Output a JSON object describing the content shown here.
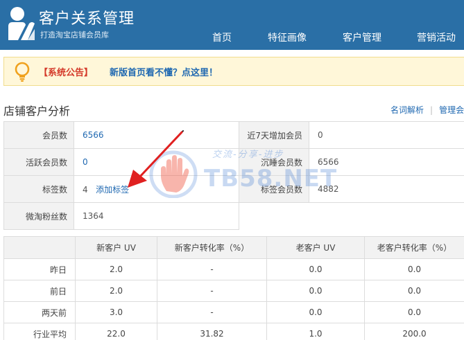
{
  "header": {
    "title": "客户关系管理",
    "subtitle": "打造淘宝店铺会员库",
    "logo_icon": "user-badge-icon",
    "bg_color": "#2a6fa6",
    "nav": [
      {
        "label": "首页"
      },
      {
        "label": "特征画像"
      },
      {
        "label": "客户管理"
      },
      {
        "label": "营销活动"
      }
    ]
  },
  "notice": {
    "icon": "lightbulb-icon",
    "tag": "【系统公告】",
    "link": "新版首页看不懂？点这里！"
  },
  "section": {
    "title": "店铺客户分析",
    "links": [
      "名词解析",
      "管理会"
    ],
    "separator": "|"
  },
  "stats": {
    "rows": [
      {
        "label1": "会员数",
        "value1": "6566",
        "value1_link": true,
        "label2": "近7天增加会员",
        "value2": "0"
      },
      {
        "label1": "活跃会员数",
        "value1": "0",
        "value1_link": true,
        "label2": "沉睡会员数",
        "value2": "6566"
      },
      {
        "label1": "标签数",
        "value1": "4",
        "add_tag": "添加标签",
        "label2": "标签会员数",
        "value2": "4882"
      },
      {
        "label1": "微淘粉丝数",
        "value1": "1364"
      }
    ]
  },
  "uv_table": {
    "headers": [
      "",
      "新客户 UV",
      "新客户转化率（%）",
      "老客户 UV",
      "老客户转化率（%）"
    ],
    "rows": [
      [
        "昨日",
        "2.0",
        "-",
        "0.0",
        "0.0"
      ],
      [
        "前日",
        "2.0",
        "-",
        "0.0",
        "0.0"
      ],
      [
        "两天前",
        "3.0",
        "-",
        "0.0",
        "0.0"
      ],
      [
        "行业平均",
        "22.0",
        "31.82",
        "1.0",
        "200.0"
      ]
    ]
  },
  "watermark": {
    "text": "TB58.NET",
    "sub": "交流-分享-进步"
  },
  "colors": {
    "accent": "#2a6fa6",
    "link": "#1f68b1",
    "notice_red": "#d43a2a",
    "arrow": "#e02020"
  }
}
